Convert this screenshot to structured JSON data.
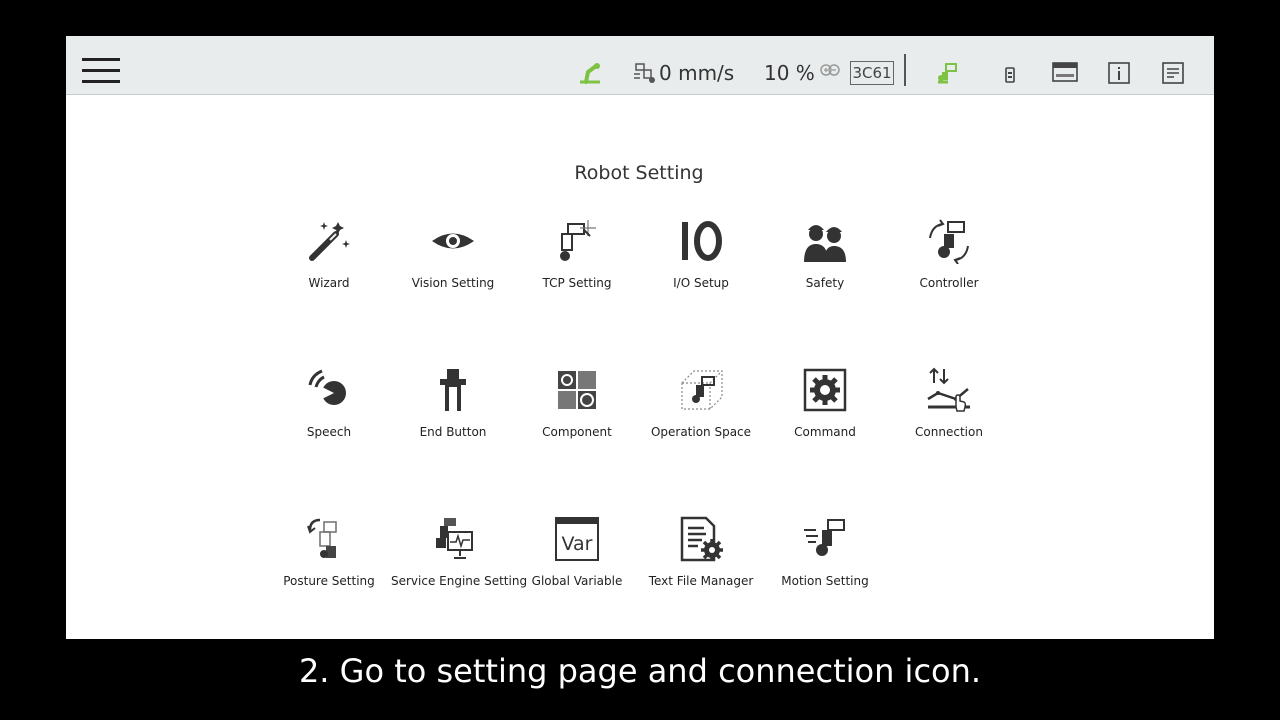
{
  "topbar": {
    "speed_value": "0 mm/s",
    "speed_percent": "10 %",
    "controller_id": "3C61"
  },
  "page": {
    "title": "Robot Setting"
  },
  "settings": [
    {
      "label": "Wizard",
      "icon": "wand-icon"
    },
    {
      "label": "Vision Setting",
      "icon": "eye-icon"
    },
    {
      "label": "TCP Setting",
      "icon": "tcp-arm-icon"
    },
    {
      "label": "I/O Setup",
      "icon": "io-icon"
    },
    {
      "label": "Safety",
      "icon": "workers-icon"
    },
    {
      "label": "Controller",
      "icon": "controller-arm-icon"
    },
    {
      "label": "Speech",
      "icon": "speech-icon"
    },
    {
      "label": "End Button",
      "icon": "gripper-icon"
    },
    {
      "label": "Component",
      "icon": "component-gear-icon"
    },
    {
      "label": "Operation Space",
      "icon": "operation-space-icon"
    },
    {
      "label": "Command",
      "icon": "command-gear-icon"
    },
    {
      "label": "Connection",
      "icon": "connection-icon"
    },
    {
      "label": "Posture Setting",
      "icon": "posture-arm-icon"
    },
    {
      "label": "Service Engine Setting",
      "icon": "service-engine-icon"
    },
    {
      "label": "Global Variable",
      "icon": "var-window-icon"
    },
    {
      "label": "Text File Manager",
      "icon": "text-file-gear-icon"
    },
    {
      "label": "Motion Setting",
      "icon": "motion-arm-icon"
    }
  ],
  "caption": "2. Go to setting page and connection icon.",
  "colors": {
    "accent_green": "#7dc243",
    "icon_dark": "#333333"
  }
}
